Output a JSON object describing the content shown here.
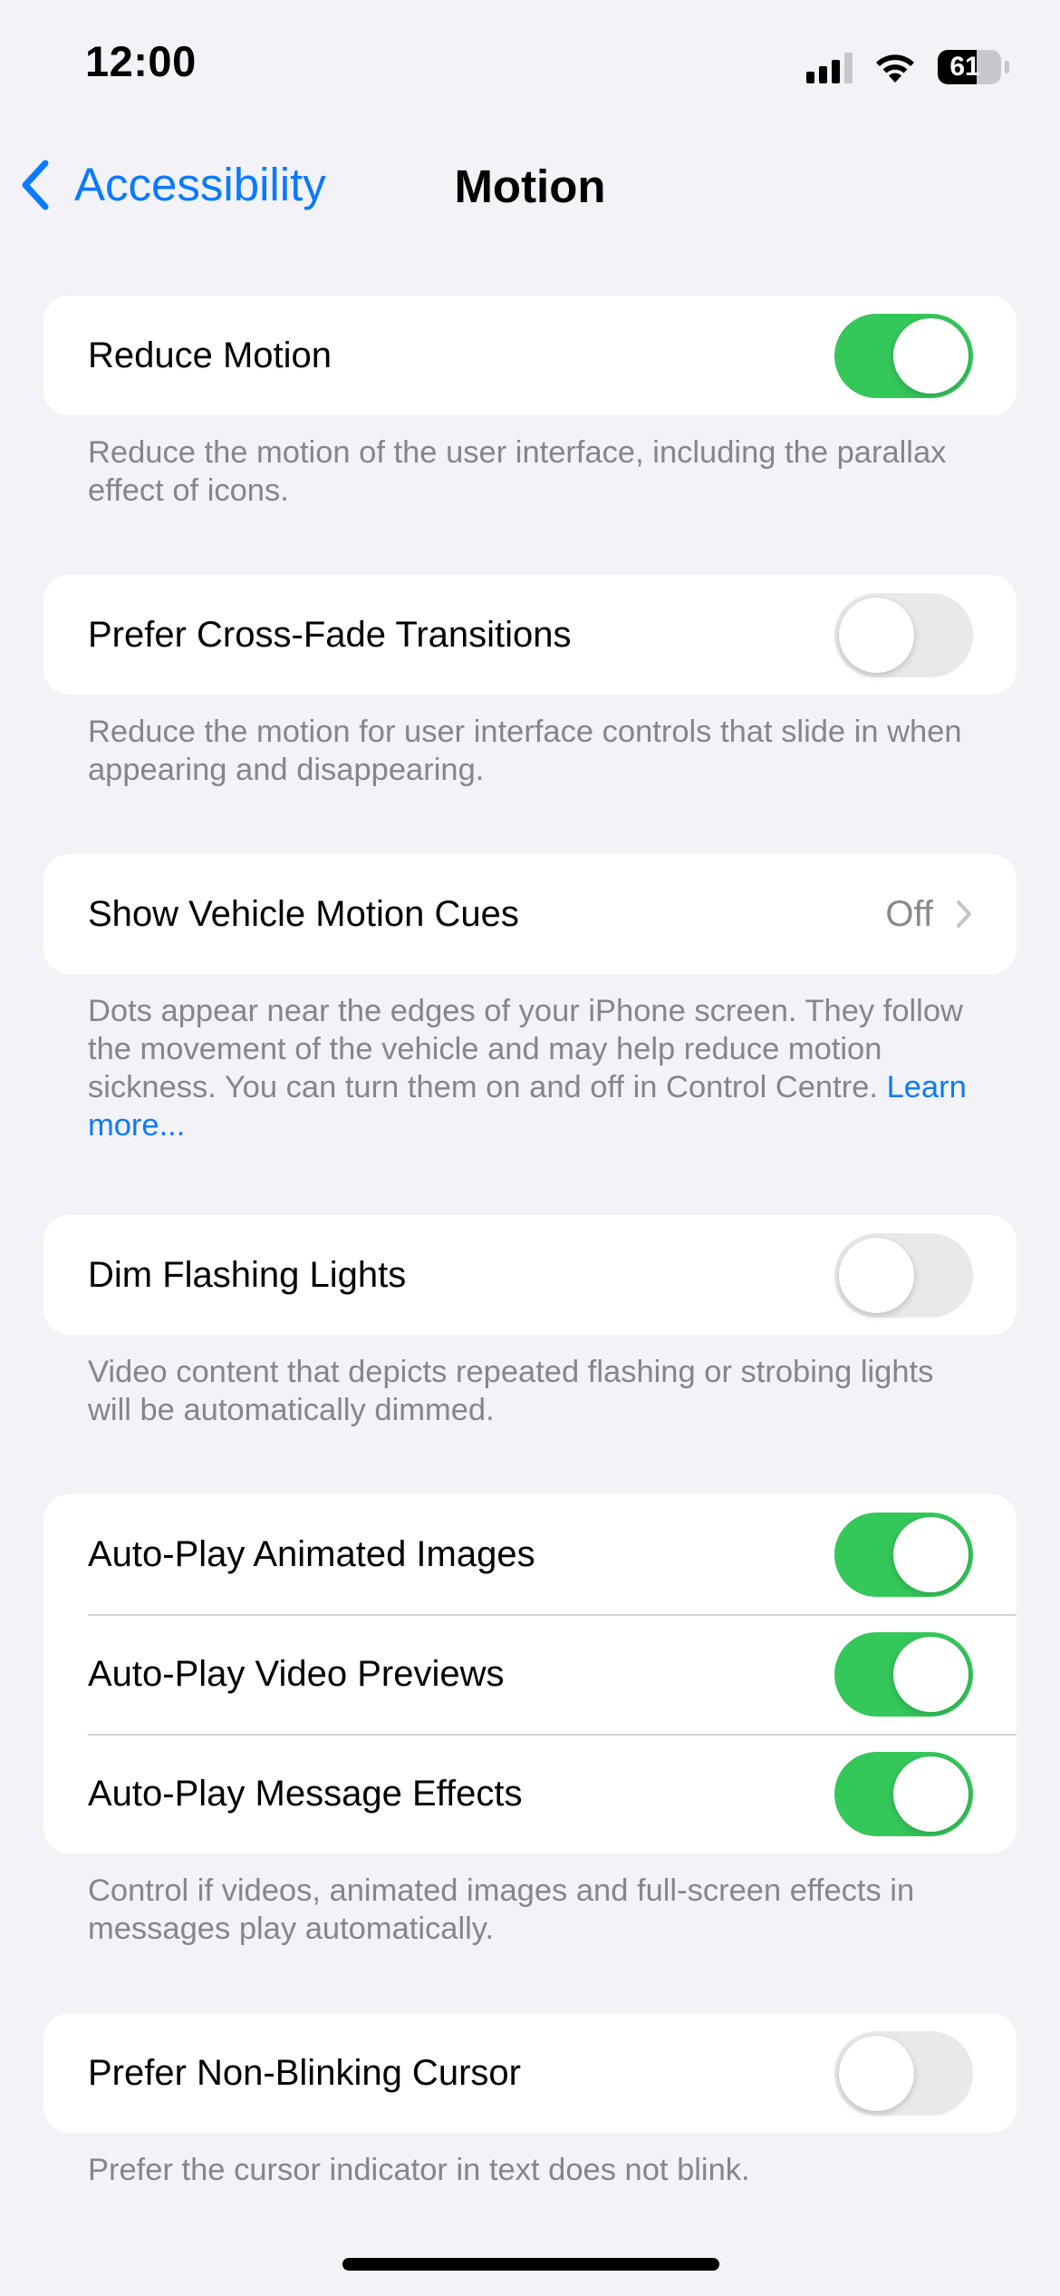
{
  "status_bar": {
    "time": "12:00",
    "battery_level": "61",
    "icons": [
      "cellular-signal-icon",
      "wifi-icon",
      "battery-icon"
    ]
  },
  "nav": {
    "back_label": "Accessibility",
    "title": "Motion"
  },
  "sections": {
    "reduce_motion": {
      "label": "Reduce Motion",
      "on": true,
      "footer": "Reduce the motion of the user interface, including the parallax effect of icons."
    },
    "cross_fade": {
      "label": "Prefer Cross-Fade Transitions",
      "on": false,
      "footer": "Reduce the motion for user interface controls that slide in when appearing and disappearing."
    },
    "vehicle_cues": {
      "label": "Show Vehicle Motion Cues",
      "value": "Off",
      "footer": "Dots appear near the edges of your iPhone screen. They follow the movement of the vehicle and may help reduce motion sickness. You can turn them on and off in Control Centre.",
      "footer_link": "Learn more..."
    },
    "dim_flashing": {
      "label": "Dim Flashing Lights",
      "on": false,
      "footer": "Video content that depicts repeated flashing or strobing lights will be automatically dimmed."
    },
    "auto_play": {
      "items": [
        {
          "label": "Auto-Play Animated Images",
          "on": true
        },
        {
          "label": "Auto-Play Video Previews",
          "on": true
        },
        {
          "label": "Auto-Play Message Effects",
          "on": true
        }
      ],
      "footer": "Control if videos, animated images and full-screen effects in messages play automatically."
    },
    "non_blinking": {
      "label": "Prefer Non-Blinking Cursor",
      "on": false,
      "footer": "Prefer the cursor indicator in text does not blink."
    }
  },
  "colors": {
    "accent": "#0a7aff",
    "toggle_on": "#34c759",
    "toggle_off": "#e9e9eb",
    "background": "#f2f2f7"
  }
}
